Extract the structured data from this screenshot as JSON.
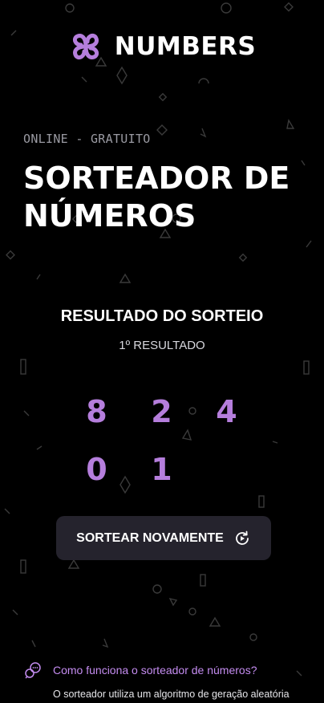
{
  "brand": {
    "name": "NUMBERS",
    "logo_icon": "flower-logo-icon",
    "accent_color": "#b57edc"
  },
  "hero": {
    "eyebrow": "ONLINE - GRATUITO",
    "title": "SORTEADOR DE NÚMEROS"
  },
  "result": {
    "heading": "RESULTADO DO SORTEIO",
    "subheading": "1º RESULTADO",
    "numbers": [
      "8",
      "2",
      "4",
      "0",
      "1"
    ]
  },
  "actions": {
    "redo_label": "SORTEAR NOVAMENTE",
    "redo_icon": "refresh-icon"
  },
  "faq": {
    "icon": "chat-bubbles-icon",
    "question": "Como funciona o sorteador de números?",
    "answer": "O sorteador utiliza um algoritmo de geração aleatória"
  },
  "colors": {
    "background": "#000000",
    "button_bg": "#25232d",
    "link": "#c48cf0"
  }
}
